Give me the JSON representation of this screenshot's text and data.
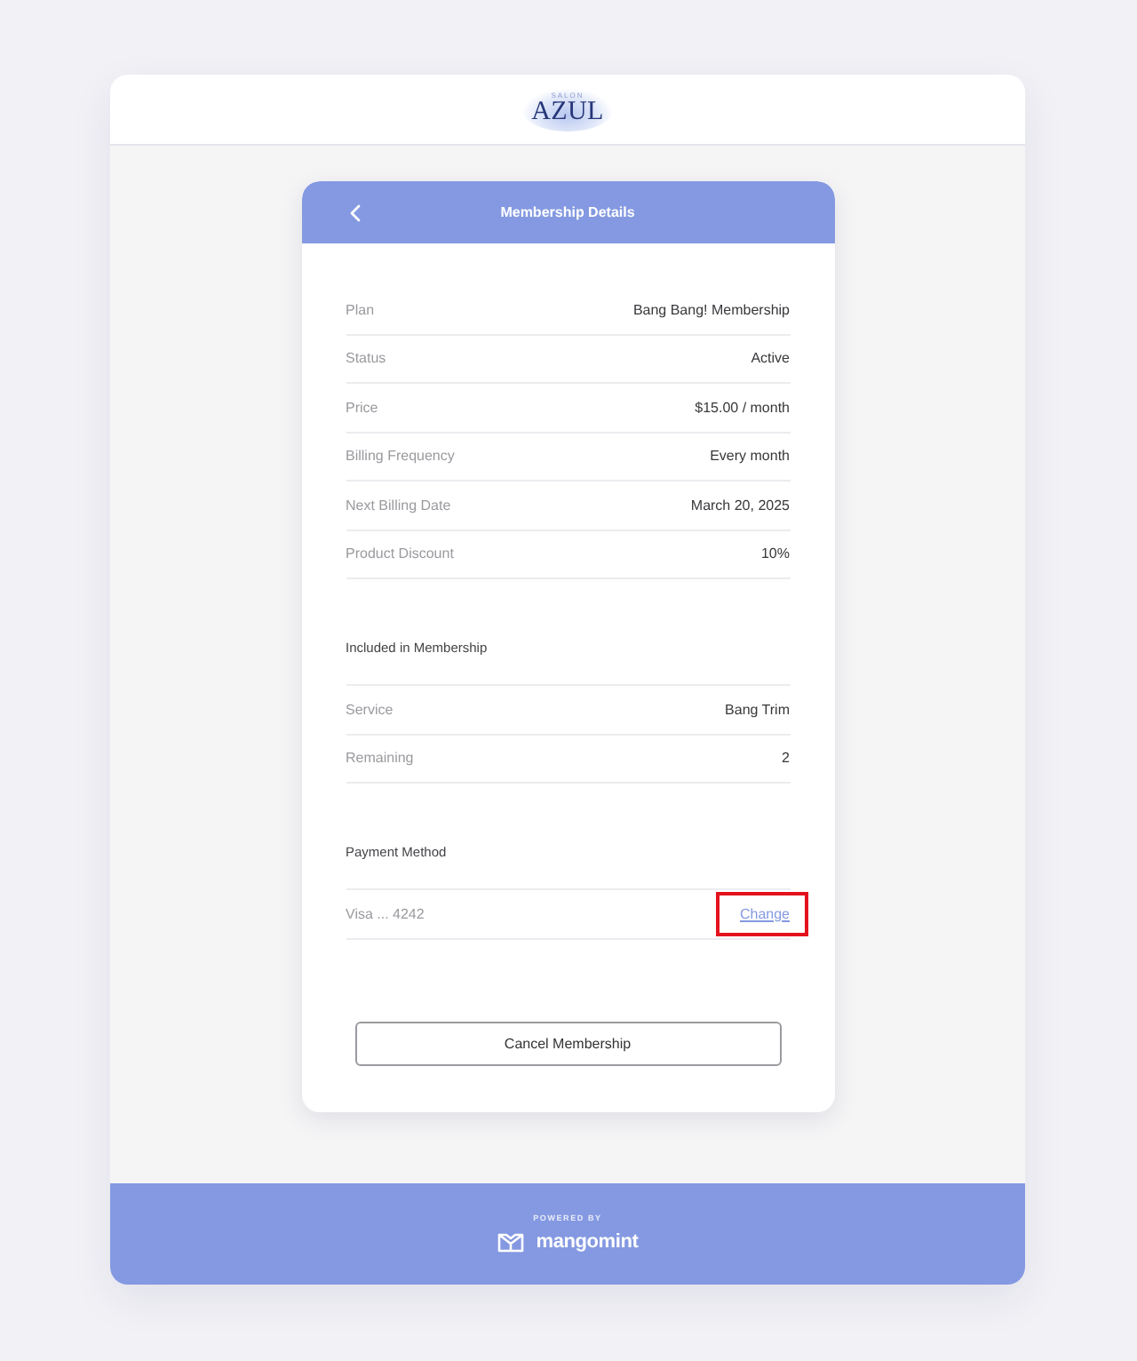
{
  "header": {
    "logo": {
      "subtitle": "SALON",
      "name": "AZUL"
    }
  },
  "card": {
    "title": "Membership Details",
    "details": [
      {
        "label": "Plan",
        "value": "Bang Bang! Membership"
      },
      {
        "label": "Status",
        "value": "Active"
      },
      {
        "label": "Price",
        "value": "$15.00 / month"
      },
      {
        "label": "Billing Frequency",
        "value": "Every month"
      },
      {
        "label": "Next Billing Date",
        "value": "March 20, 2025"
      },
      {
        "label": "Product Discount",
        "value": "10%"
      }
    ],
    "included": {
      "heading": "Included in Membership",
      "rows": [
        {
          "label": "Service",
          "value": "Bang Trim"
        },
        {
          "label": "Remaining",
          "value": "2"
        }
      ]
    },
    "payment": {
      "heading": "Payment Method",
      "card": "Visa ... 4242",
      "action": {
        "label": "Change",
        "highlighted": true
      }
    },
    "cancel_button": "Cancel Membership"
  },
  "footer": {
    "powered_by": "POWERED BY",
    "brand": "mangomint"
  }
}
